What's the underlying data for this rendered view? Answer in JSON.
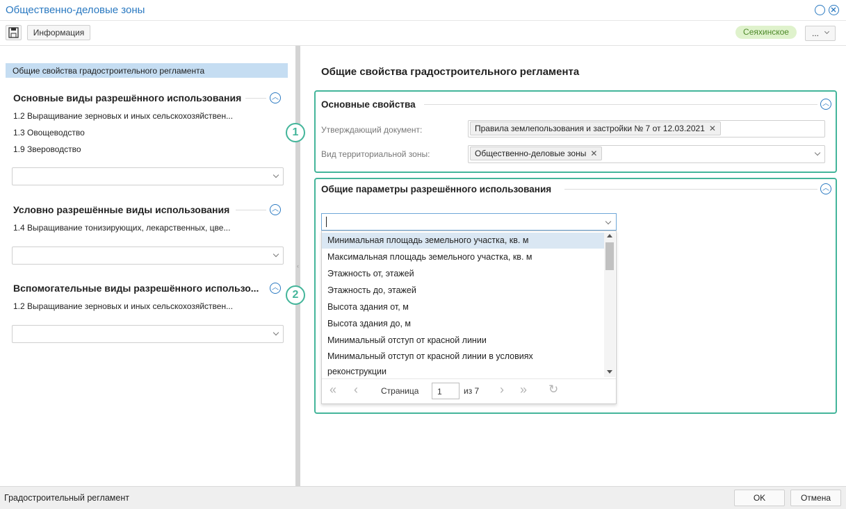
{
  "window": {
    "title": "Общественно-деловые зоны"
  },
  "toolbar": {
    "info_label": "Информация",
    "region": "Сеяхинское",
    "more_label": "..."
  },
  "left": {
    "selected_item": "Общие свойства градостроительного регламента",
    "sections": [
      {
        "title": "Основные виды разрешённого использования",
        "items": [
          "1.2 Выращивание зерновых и иных сельскохозяйствен...",
          "1.3 Овощеводство",
          "1.9 Звероводство"
        ]
      },
      {
        "title": "Условно разрешённые виды использования",
        "items": [
          "1.4 Выращивание тонизирующих, лекарственных, цве..."
        ]
      },
      {
        "title": "Вспомогательные виды разрешённого использо...",
        "items": [
          "1.2 Выращивание зерновых и иных сельскохозяйствен..."
        ]
      }
    ]
  },
  "right": {
    "title": "Общие свойства градостроительного регламента",
    "basic": {
      "title": "Основные свойства",
      "doc_label": "Утверждающий документ:",
      "doc_tag": "Правила землепользования и застройки № 7 от 12.03.2021",
      "zone_label": "Вид территориальной зоны:",
      "zone_tag": "Общественно-деловые зоны"
    },
    "params": {
      "title": "Общие параметры разрешённого использования"
    },
    "markers": [
      "1",
      "2"
    ]
  },
  "dropdown": {
    "options": [
      "Минимальная площадь земельного участка, кв. м",
      "Максимальная площадь земельного участка, кв. м",
      "Этажность от, этажей",
      "Этажность до, этажей",
      "Высота здания от, м",
      "Высота здания до, м",
      "Минимальный отступ от красной линии",
      "Минимальный отступ от красной линии в условиях",
      "реконструкции"
    ],
    "pager": {
      "page_label": "Страница",
      "page_value": "1",
      "of_label": "из 7"
    }
  },
  "status": {
    "text": "Градостроительный регламент",
    "ok": "OK",
    "cancel": "Отмена"
  },
  "colors": {
    "accent": "#2a79c1",
    "group_border": "#43b59a",
    "badge_bg": "#dff2cc",
    "selection": "#c5ddf2"
  }
}
